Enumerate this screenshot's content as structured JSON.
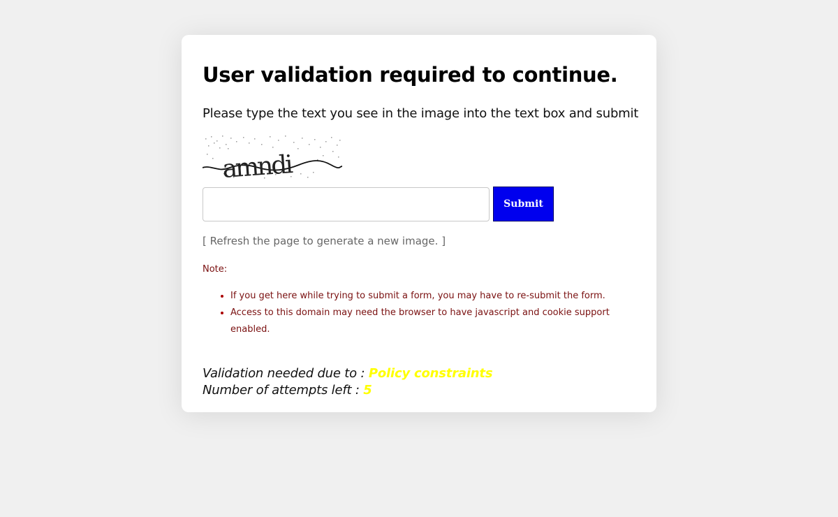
{
  "page": {
    "title": "User validation required to continue.",
    "instructions": "Please type the text you see in the image into the text box and submit"
  },
  "captcha": {
    "image_text": "amndi",
    "input_value": "",
    "input_placeholder": "",
    "submit_label": "Submit",
    "refresh_hint": "[ Refresh the page to generate a new image. ]"
  },
  "note": {
    "label": "Note:",
    "items": [
      "If you get here while trying to submit a form, you may have to re-submit the form.",
      "Access to this domain may need the browser to have javascript and cookie support enabled."
    ]
  },
  "validation": {
    "reason_label": "Validation needed due to : ",
    "reason_value": "Policy constraints",
    "attempts_label": "Number of attempts left : ",
    "attempts_value": "5"
  },
  "colors": {
    "background": "#f0f0f0",
    "card": "#ffffff",
    "submit_button": "#0000ee",
    "note_text": "#7a1010",
    "highlight": "#ffff00"
  },
  "icons": {
    "captcha": "captcha-image"
  }
}
